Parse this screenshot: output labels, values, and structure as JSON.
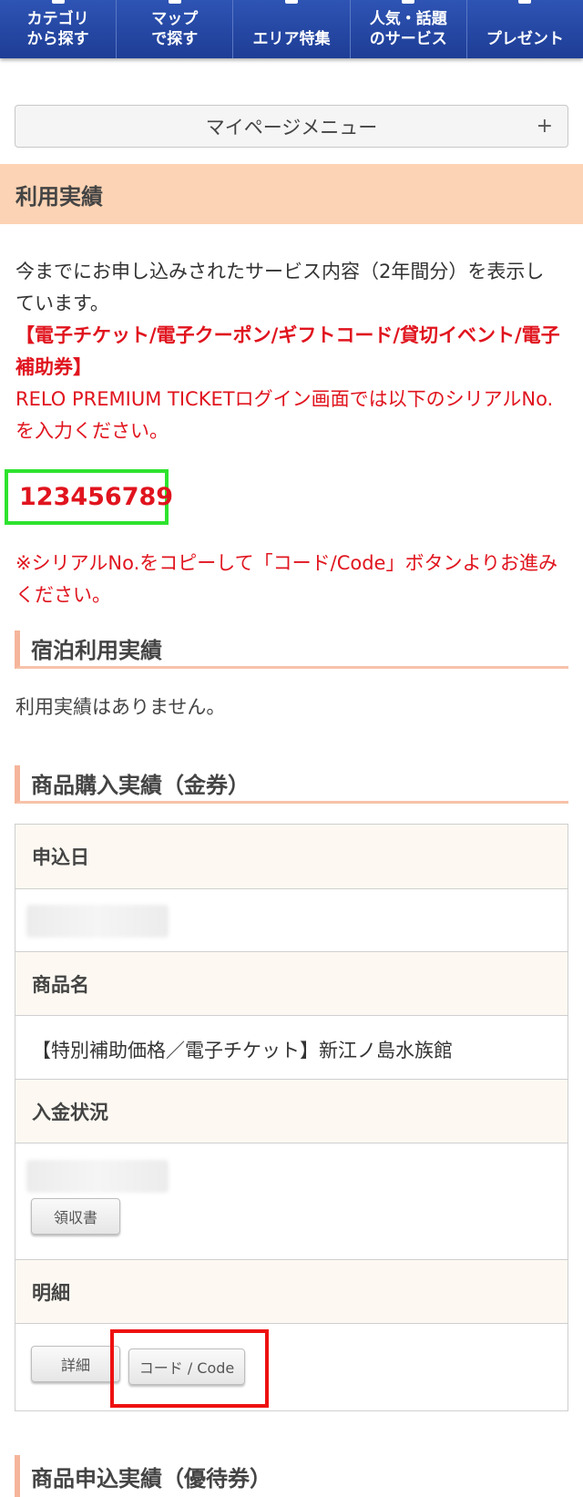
{
  "nav": [
    {
      "label": "カテゴリ\nから探す"
    },
    {
      "label": "マップ\nで探す"
    },
    {
      "label": "エリア特集"
    },
    {
      "label": "人気・話題\nのサービス"
    },
    {
      "label": "プレゼント"
    }
  ],
  "mypage_menu": {
    "label": "マイページメニュー",
    "toggle": "+"
  },
  "section_title": "利用実績",
  "intro": {
    "line1": "今までにお申し込みされたサービス内容（2年間分）を表示しています。",
    "line2": "【電子チケット/電子クーポン/ギフトコード/貸切イベント/電子補助券】",
    "line3": "RELO PREMIUM TICKETログイン画面では以下のシリアルNo.を入力ください。"
  },
  "serial_number": "123456789",
  "note": "※シリアルNo.をコピーして「コード/Code」ボタンよりお進みください。",
  "lodging": {
    "title": "宿泊利用実績",
    "empty": "利用実績はありません。"
  },
  "purchase": {
    "title": "商品購入実績（金券）",
    "apply_date_label": "申込日",
    "product_name_label": "商品名",
    "product_name": "【特別補助価格／電子チケット】新江ノ島水族館",
    "payment_status_label": "入金状況",
    "receipt_button": "領収書",
    "detail_label": "明細",
    "detail_button": "詳細",
    "code_button": "コード / Code"
  },
  "next_section_title": "商品申込実績（優待券）"
}
